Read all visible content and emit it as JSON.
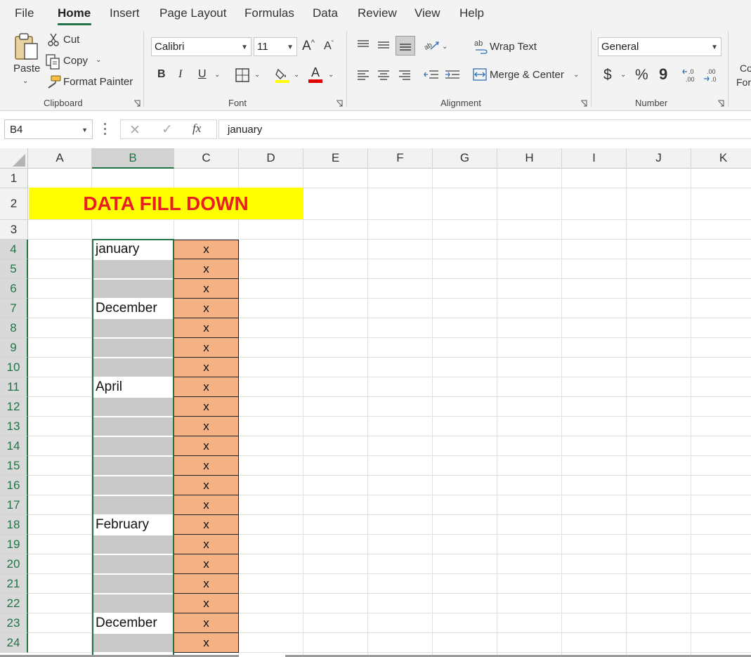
{
  "menu": {
    "tabs": [
      "File",
      "Home",
      "Insert",
      "Page Layout",
      "Formulas",
      "Data",
      "Review",
      "View",
      "Help"
    ],
    "active": "Home"
  },
  "ribbon": {
    "clipboard": {
      "paste": "Paste",
      "cut": "Cut",
      "copy": "Copy",
      "format_painter": "Format Painter",
      "label": "Clipboard"
    },
    "font": {
      "name": "Calibri",
      "size": "11",
      "bold": "B",
      "italic": "I",
      "underline": "U",
      "font_color_letter": "A",
      "grow": "A",
      "shrink": "A",
      "label": "Font"
    },
    "alignment": {
      "wrap_text": "Wrap Text",
      "merge_center": "Merge & Center",
      "label": "Alignment"
    },
    "number": {
      "format": "General",
      "currency": "$",
      "percent": "%",
      "comma": "9",
      "label": "Number"
    },
    "styles_partial": {
      "line1": "Co",
      "line2": "For"
    }
  },
  "formula_bar": {
    "name_box": "B4",
    "fx": "fx",
    "value": "january"
  },
  "sheet": {
    "columns": [
      "A",
      "B",
      "C",
      "D",
      "E",
      "F",
      "G",
      "H",
      "I",
      "J",
      "K"
    ],
    "rows": [
      "1",
      "2",
      "3",
      "4",
      "5",
      "6",
      "7",
      "8",
      "9",
      "10",
      "11",
      "12",
      "13",
      "14",
      "15",
      "16",
      "17",
      "18",
      "19",
      "20",
      "21",
      "22",
      "23",
      "24"
    ],
    "title": "DATA FILL DOWN",
    "column_b": [
      "january",
      "",
      "",
      "December",
      "",
      "",
      "",
      "April",
      "",
      "",
      "",
      "",
      "",
      "",
      "February",
      "",
      "",
      "",
      "",
      "December",
      ""
    ],
    "column_c": [
      "x",
      "x",
      "x",
      "x",
      "x",
      "x",
      "x",
      "x",
      "x",
      "x",
      "x",
      "x",
      "x",
      "x",
      "x",
      "x",
      "x",
      "x",
      "x",
      "x",
      "x"
    ],
    "colors": {
      "title_bg": "#ffff00",
      "title_text": "#ea1c24",
      "blank_fill": "#c9c9c9",
      "c_fill": "#f4b183",
      "accent": "#217346"
    }
  }
}
